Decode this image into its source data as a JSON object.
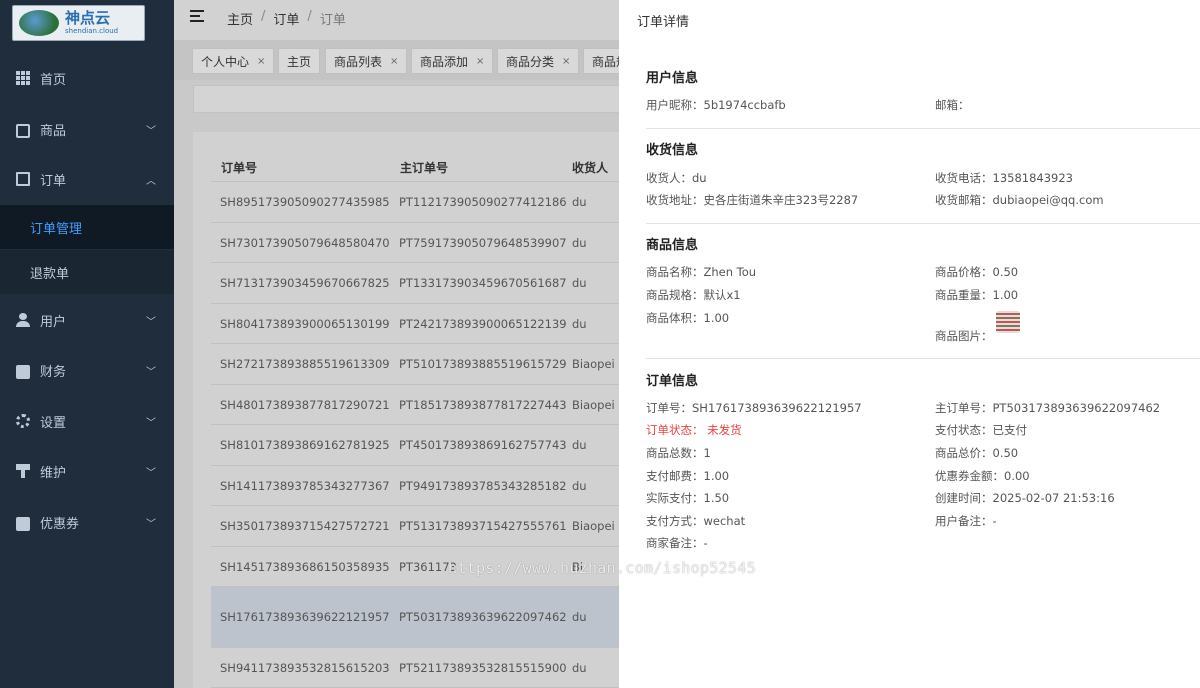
{
  "logo": {
    "cn": "神点云",
    "en": "shendian.cloud"
  },
  "sidebar": {
    "items": [
      {
        "label": "首页",
        "icon": "grid-icon"
      },
      {
        "label": "商品",
        "icon": "bag-icon"
      },
      {
        "label": "订单",
        "icon": "list-icon"
      },
      {
        "label": "用户",
        "icon": "user-icon"
      },
      {
        "label": "财务",
        "icon": "wallet-icon"
      },
      {
        "label": "设置",
        "icon": "gear-icon"
      },
      {
        "label": "维护",
        "icon": "tool-icon"
      },
      {
        "label": "优惠券",
        "icon": "ticket-icon"
      }
    ],
    "order_sub": [
      "订单管理",
      "退款单"
    ]
  },
  "breadcrumb": [
    "主页",
    "订单",
    "订单"
  ],
  "tags": [
    "个人中心",
    "主页",
    "商品列表",
    "商品添加",
    "商品分类",
    "商品规"
  ],
  "table": {
    "headers": [
      "订单号",
      "主订单号",
      "收货人"
    ],
    "rows": [
      [
        "SH895173905090277435985",
        "PT112173905090277412186",
        "du"
      ],
      [
        "SH730173905079648580470",
        "PT759173905079648539907",
        "du"
      ],
      [
        "SH713173903459670667825",
        "PT133173903459670561687",
        "du"
      ],
      [
        "SH804173893900065130199",
        "PT242173893900065122139",
        "du"
      ],
      [
        "SH272173893885519613309",
        "PT510173893885519615729",
        "Biaopei"
      ],
      [
        "SH480173893877817290721",
        "PT185173893877817227443",
        "Biaopei"
      ],
      [
        "SH810173893869162781925",
        "PT450173893869162757743",
        "du"
      ],
      [
        "SH141173893785343277367",
        "PT949173893785343285182",
        "du"
      ],
      [
        "SH350173893715427572721",
        "PT513173893715427555761",
        "Biaopei"
      ],
      [
        "SH145173893686150358935",
        "PT361173",
        "Bi"
      ],
      [
        "SH176173893639622121957",
        "PT503173893639622097462",
        "du"
      ],
      [
        "SH941173893532815615203",
        "PT521173893532815515900",
        "du"
      ]
    ]
  },
  "drawer": {
    "title": "订单详情",
    "user_section": {
      "title": "用户信息",
      "nickname": "用户昵称：5b1974ccbafb",
      "email": "邮箱："
    },
    "shipping_section": {
      "title": "收货信息",
      "receiver": "收货人：du",
      "phone": "收货电话：13581843923",
      "address": "收货地址：史各庄街道朱辛庄323号2287",
      "ship_email": "收货邮箱：dubiaopei@qq.com"
    },
    "goods_section": {
      "title": "商品信息",
      "name": "商品名称：Zhen Tou",
      "price": "商品价格：0.50",
      "spec": "商品规格：默认x1",
      "weight": "商品重量：1.00",
      "volume": "商品体积：1.00",
      "image_label": "商品图片："
    },
    "order_section": {
      "title": "订单信息",
      "order_no": "订单号：SH176173893639622121957",
      "main_order_no": "主订单号：PT503173893639622097462",
      "status": "订单状态：  未发货",
      "pay_status": "支付状态：已支付",
      "total_count": "商品总数：1",
      "total_price": "商品总价：0.50",
      "postage": "支付邮费：1.00",
      "coupon": "优惠券金额：0.00",
      "actual": "实际支付：1.50",
      "created": "创建时间：2025-02-07 21:53:16",
      "pay_method": "支付方式：wechat",
      "user_note": "用户备注：-",
      "merchant_note": "商家备注：-"
    }
  },
  "watermark": "https://www.huzhan.com/ishop52545",
  "colors": {
    "sidebar_bg": "#1f2d3d",
    "active": "#409eff",
    "status_red": "#f04040"
  }
}
